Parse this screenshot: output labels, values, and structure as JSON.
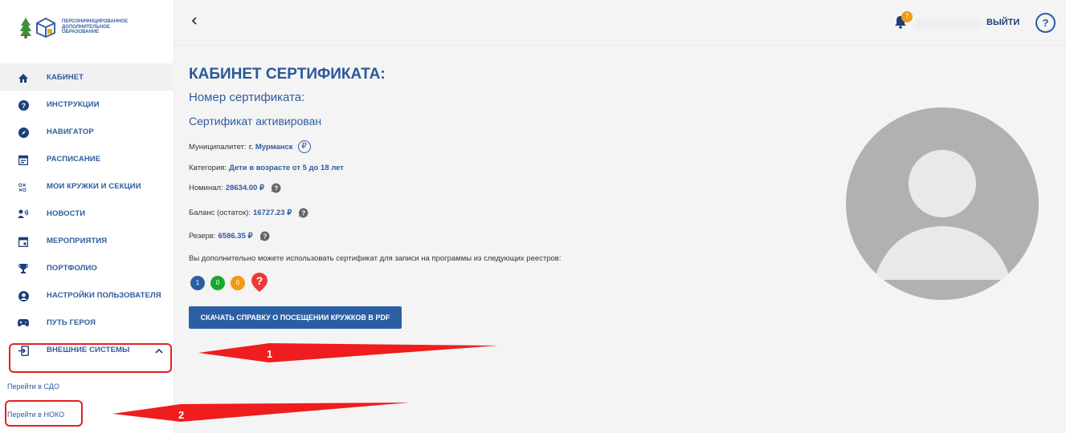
{
  "logo": {
    "lines": [
      "ПЕРСОНИФИЦИРОВАННОЕ",
      "ДОПОЛНИТЕЛЬНОЕ",
      "ОБРАЗОВАНИЕ"
    ]
  },
  "sidebar": {
    "items": [
      {
        "label": "КАБИНЕТ",
        "icon": "home-icon"
      },
      {
        "label": "ИНСТРУКЦИИ",
        "icon": "question-icon"
      },
      {
        "label": "НАВИГАТОР",
        "icon": "compass-icon"
      },
      {
        "label": "РАСПИСАНИЕ",
        "icon": "calendar-icon"
      },
      {
        "label": "МОИ КРУЖКИ И СЕКЦИИ",
        "icon": "tictactoe-icon"
      },
      {
        "label": "НОВОСТИ",
        "icon": "speaker-icon"
      },
      {
        "label": "МЕРОПРИЯТИЯ",
        "icon": "event-icon"
      },
      {
        "label": "ПОРТФОЛИО",
        "icon": "trophy-icon"
      },
      {
        "label": "НАСТРОЙКИ ПОЛЬЗОВАТЕЛЯ",
        "icon": "user-circle-icon"
      },
      {
        "label": "ПУТЬ ГЕРОЯ",
        "icon": "gamepad-icon"
      },
      {
        "label": "ВНЕШНИЕ СИСТЕМЫ",
        "icon": "login-icon"
      }
    ],
    "sub_items": [
      "Перейти в СДО",
      "Перейти в НОКО"
    ]
  },
  "topbar": {
    "back": "<",
    "badge": "7",
    "logout": "ВЫЙТИ",
    "help": "?"
  },
  "main": {
    "title": "КАБИНЕТ СЕРТИФИКАТА:",
    "cert_number": "Номер сертификата:",
    "status": "Сертификат активирован",
    "municipality_label": "Муниципалитет:",
    "municipality": "г. Мурманск",
    "ruble_symbol": "₽",
    "category_label": "Категория:",
    "category": "Дети в возрасте от 5 до 18 лет",
    "nominal_label": "Номинал:",
    "nominal": "28634.00 ₽",
    "balance_label": "Баланс (остаток):",
    "balance": "16727.23 ₽",
    "reserve_label": "Резерв:",
    "reserve": "6586.35 ₽",
    "registries_text": "Вы дополнительно можете использовать сертификат для записи на программы из следующих реестров:",
    "registry_counts": [
      "1",
      "0",
      "0"
    ],
    "pdf_button": "СКАЧАТЬ СПРАВКУ О ПОСЕЩЕНИИ КРУЖКОВ В PDF"
  },
  "annotations": [
    "1",
    "2"
  ],
  "colors": {
    "brand": "#2d5d9f",
    "button": "#2b5fa3",
    "annotation": "#e52020",
    "badge": "#f29a12"
  }
}
